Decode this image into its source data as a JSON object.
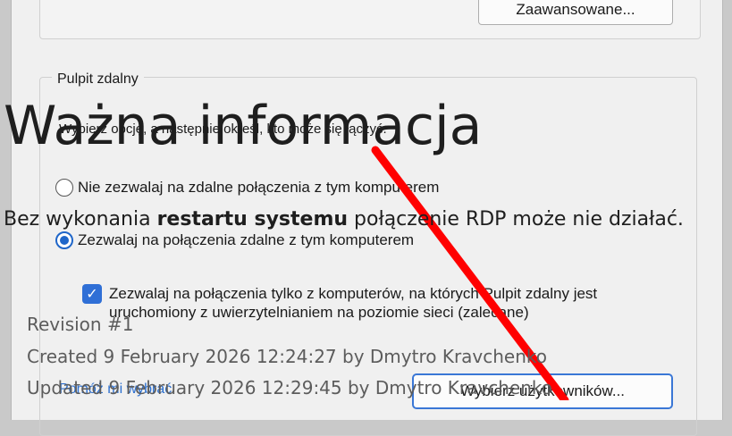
{
  "dialog": {
    "advanced_button": "Zaawansowane...",
    "remote_desktop_group": "Pulpit zdalny",
    "hint_text": "Wybierz opcję, a następnie określ, kto może się łączyć.",
    "radio_deny": "Nie zezwalaj na zdalne połączenia z tym komputerem",
    "radio_allow": "Zezwalaj na połączenia zdalne z tym komputerem",
    "nla_checkbox": "Zezwalaj na połączenia tylko z komputerów, na których Pulpit zdalny jest uruchomiony z uwierzytelnianiem na poziomie sieci (zalecane)",
    "help_link": "Pomóż mi wybrać",
    "select_users_button": "Wybierz użytkowników..."
  },
  "overlay": {
    "title": "Ważna informacja",
    "message_prefix": "Bez wykonania ",
    "message_bold": "restartu systemu",
    "message_suffix": " połączenie RDP może nie działać."
  },
  "revision": {
    "label": "Revision #1",
    "created": "Created 9 February 2026 12:24:27 by Dmytro Kravchenko",
    "updated": "Updated 9 February 2026 12:29:45 by Dmytro Kravchenko"
  },
  "colors": {
    "accent": "#1f66c9",
    "annotation_arrow": "#ff0000"
  }
}
